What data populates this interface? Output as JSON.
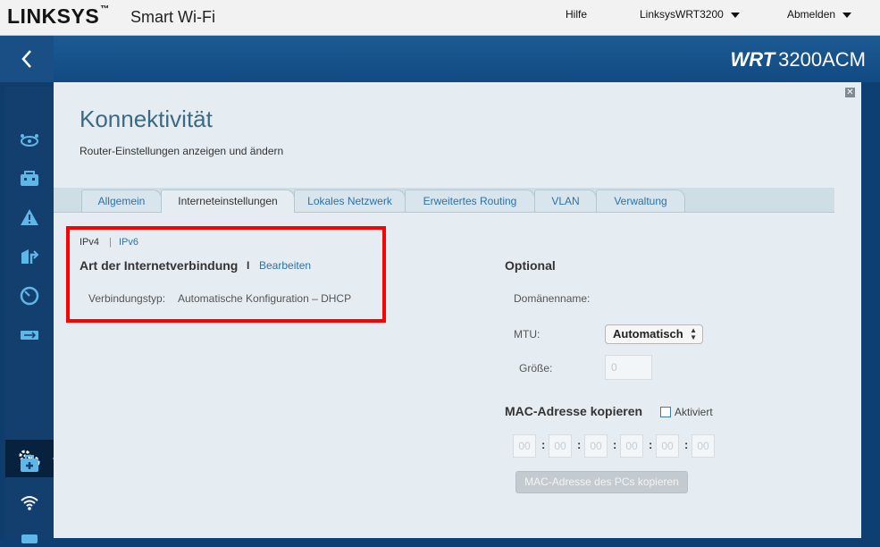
{
  "header": {
    "brand": "LINKSYS",
    "brand_tm": "™",
    "product": "Smart Wi-Fi",
    "help": "Hilfe",
    "router_name": "LinksysWRT3200",
    "logout": "Abmelden"
  },
  "model": {
    "prefix": "WRT",
    "name": "3200ACM"
  },
  "page": {
    "title": "Konnektivität",
    "subtitle": "Router-Einstellungen anzeigen und ändern"
  },
  "tabs": [
    {
      "label": "Allgemein",
      "active": false
    },
    {
      "label": "Interneteinstellungen",
      "active": true
    },
    {
      "label": "Lokales Netzwerk",
      "active": false
    },
    {
      "label": "Erweitertes Routing",
      "active": false
    },
    {
      "label": "VLAN",
      "active": false
    },
    {
      "label": "Verwaltung",
      "active": false
    }
  ],
  "internet": {
    "ipv4": "IPv4",
    "sep": "|",
    "ipv6": "IPv6",
    "section_title": "Art der Internetverbindung",
    "edit_sep": "I",
    "edit": "Bearbeiten",
    "conn_label": "Verbindungstyp:",
    "conn_value": "Automatische Konfiguration – DHCP"
  },
  "optional": {
    "title": "Optional",
    "domain_label": "Domänenname:",
    "mtu_label": "MTU:",
    "mtu_value": "Automatisch",
    "size_label": "Größe:",
    "size_value": "0"
  },
  "mac": {
    "title": "MAC-Adresse kopieren",
    "enabled_label": "Aktiviert",
    "octets": [
      "00",
      "00",
      "00",
      "00",
      "00",
      "00"
    ],
    "copy_button": "MAC-Adresse des PCs kopieren"
  }
}
